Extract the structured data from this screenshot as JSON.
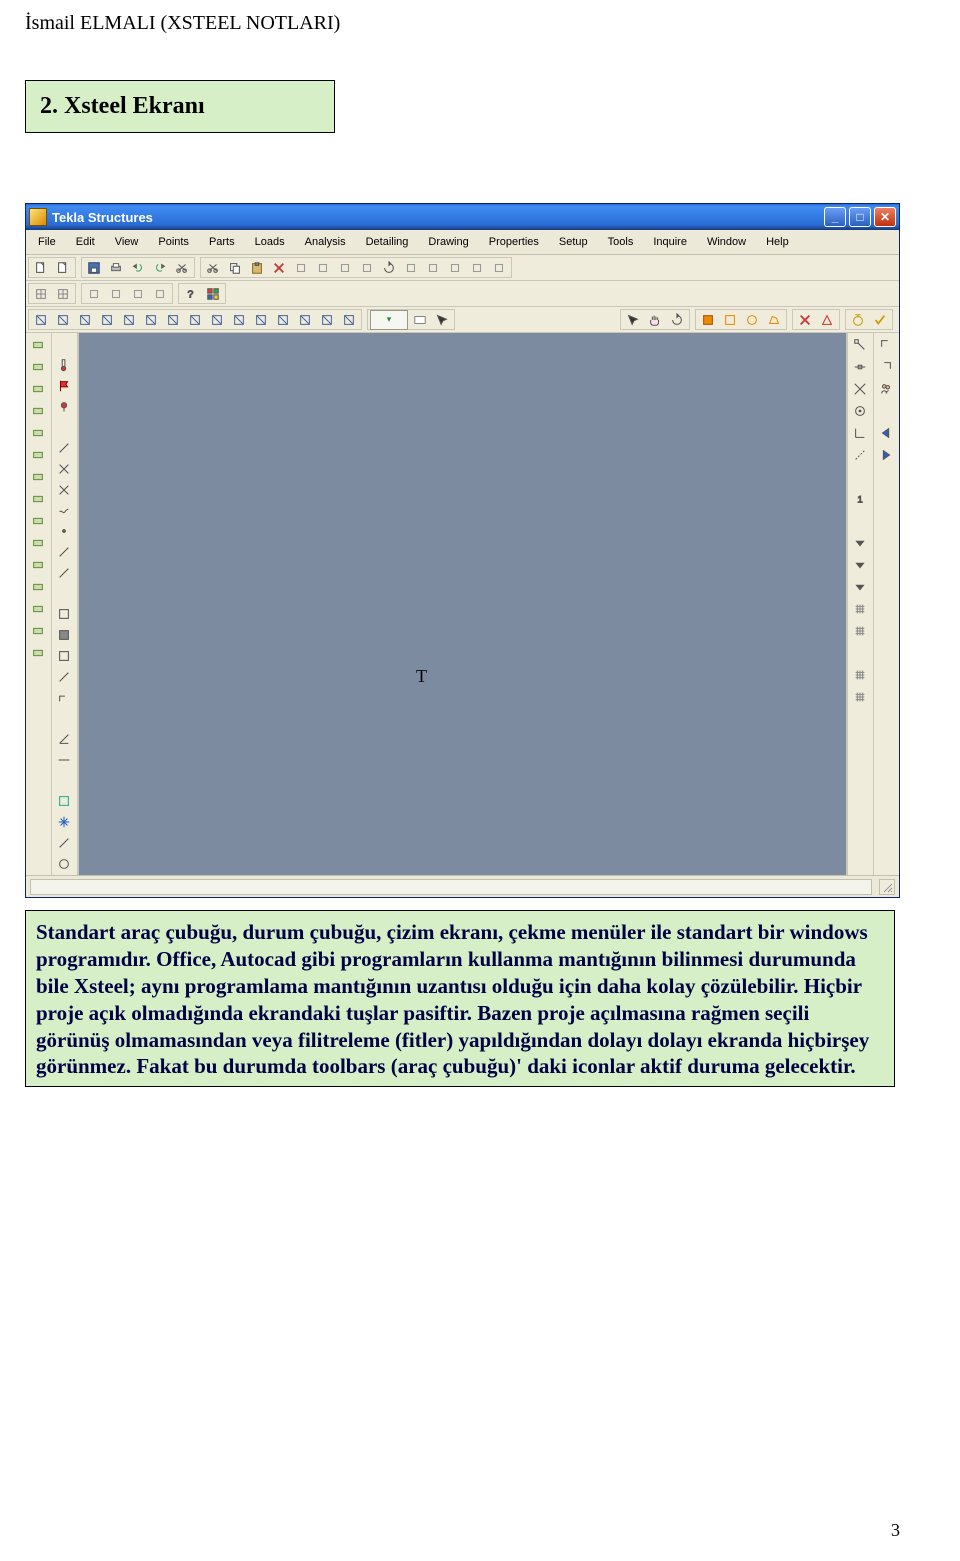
{
  "doc": {
    "header": "İsmail ELMALI (XSTEEL NOTLARI)",
    "section_title": "2. Xsteel Ekranı",
    "page_number": "3"
  },
  "app": {
    "title": "Tekla Structures",
    "status_char": "T",
    "menu": [
      "File",
      "Edit",
      "View",
      "Points",
      "Parts",
      "Loads",
      "Analysis",
      "Detailing",
      "Drawing",
      "Properties",
      "Setup",
      "Tools",
      "Inquire",
      "Window",
      "Help"
    ]
  },
  "toolbar1": {
    "groups": [
      [
        "new-file-icon",
        "open-file-icon"
      ],
      [
        "save-icon",
        "print-icon",
        "undo-icon",
        "redo-icon",
        "scissors-icon"
      ],
      [
        "cut-icon",
        "copy-icon",
        "paste-icon",
        "delete-icon",
        "find-icon",
        "zoom-window-icon",
        "zoom-all-icon",
        "pan-icon",
        "rotate-icon",
        "repeat-icon",
        "select-icon",
        "deselect-icon",
        "settings-icon",
        "help-icon"
      ]
    ]
  },
  "toolbar2": {
    "groups": [
      [
        "grid-icon",
        "grid-point-icon"
      ],
      [
        "point-icon",
        "line-icon",
        "polyline-icon",
        "polygon-icon"
      ],
      [
        "question-icon",
        "color-icon"
      ]
    ]
  },
  "toolbar3": {
    "groupA": [
      "view-icon-1",
      "view-icon-2",
      "view-icon-3",
      "view-icon-4",
      "view-icon-5",
      "view-icon-6",
      "view-icon-7",
      "view-icon-8",
      "view-icon-9",
      "view-icon-10",
      "view-icon-11",
      "view-icon-12",
      "view-icon-13",
      "view-icon-14",
      "view-icon-15"
    ],
    "groupB": [
      "dd-icon",
      "dd-arrow-icon"
    ],
    "groupC": [
      "arrow-icon",
      "hand-icon",
      "rotate-view-icon"
    ],
    "groupD": [
      "sel-orange-icon",
      "sel-box-icon",
      "sel-circle-icon",
      "sel-poly-icon"
    ],
    "groupE": [
      "x-red-icon",
      "mark-icon"
    ],
    "groupF": [
      "timer-icon",
      "check-icon"
    ]
  },
  "leftcol1": [
    "beam-icon",
    "col-icon",
    "plate-icon",
    "bolt-icon",
    "weld-icon",
    "contour-icon",
    "poly-plate-icon",
    "slab-icon",
    "rebar-icon",
    "mesh-icon",
    "pad-icon",
    "conn-icon",
    "det-icon",
    "cut-part-icon",
    "fit-icon"
  ],
  "leftcol2": [
    "",
    "thermo-icon",
    "flag-icon",
    "pin-icon",
    "",
    "slash-icon",
    "x-mark-icon",
    "cross-icon",
    "tilde-icon",
    "dot-icon",
    "slash2-icon",
    "slash3-icon",
    "",
    "box-outline-icon",
    "box-fill-icon",
    "nobox-icon",
    "line-seg-icon",
    "corner-icon",
    "",
    "angle-icon",
    "horiz-icon",
    "",
    "vp-icon",
    "asterisk-icon",
    "slice-icon",
    "circle-icon"
  ],
  "rightcol1": [
    "snap-end-icon",
    "snap-mid-icon",
    "snap-int-icon",
    "snap-center-icon",
    "snap-perp-icon",
    "snap-ext-icon",
    "",
    "num-1-icon",
    "",
    "down-1-icon",
    "down-2-icon",
    "down-3-icon",
    "grid-snap-icon",
    "mesh-snap-icon",
    "",
    "layer-1-icon",
    "layer-2-icon"
  ],
  "rightcol2": [
    "corner-tl-icon",
    "corner-tr-icon",
    "people-icon",
    "",
    "arrow-left-icon",
    "arrow-right-icon"
  ],
  "explain": {
    "text": "Standart araç çubuğu, durum çubuğu, çizim ekranı, çekme menüler ile standart bir windows programıdır. Office, Autocad gibi programların kullanma mantığının bilinmesi durumunda bile Xsteel; aynı programlama mantığının uzantısı olduğu için daha kolay çözülebilir. Hiçbir proje açık olmadığında ekrandaki tuşlar pasiftir. Bazen proje açılmasına rağmen seçili görünüş olmamasından veya filitreleme (fitler) yapıldığından dolayı dolayı ekranda hiçbirşey görünmez. Fakat bu durumda toolbars (araç çubuğu)' daki iconlar aktif duruma gelecektir."
  }
}
